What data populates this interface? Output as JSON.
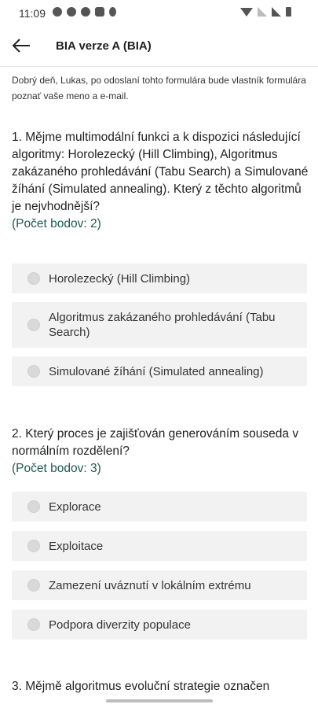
{
  "status_bar": {
    "time": "11:09"
  },
  "header": {
    "title": "BIA verze A (BIA)"
  },
  "intro": "Dobrý deň, Lukas, po odoslaní tohto formulára bude vlastník formulára poznať vaše meno a e-mail.",
  "questions": [
    {
      "text": "1. Mějme multimodální funkci a k dispozici následující algoritmy: Horolezecký (Hill Climbing), Algoritmus zakázaného prohledávání (Tabu Search) a Simulované žíhání (Simulated annealing). Který z těchto algoritmů je nejvhodnější?",
      "points": "(Počet bodov: 2)",
      "options": [
        "Horolezecký (Hill Climbing)",
        "Algoritmus zakázaného prohledávání (Tabu Search)",
        "Simulované žíhání (Simulated annealing)"
      ]
    },
    {
      "text": "2. Který proces je zajišťován generováním souseda v normálním rozdělení?",
      "points": "(Počet bodov: 3)",
      "options": [
        "Explorace",
        "Exploitace",
        "Zamezení uváznutí v lokálním extrému",
        "Podpora diverzity populace"
      ]
    },
    {
      "text": "3. Mějmě algoritmus evoluční strategie označen"
    }
  ],
  "colors": {
    "points": "#1d5b4f",
    "option_bg": "#f2f2f2"
  },
  "icons": {
    "back": "arrow-left-icon",
    "radio": "radio-unchecked-icon"
  }
}
